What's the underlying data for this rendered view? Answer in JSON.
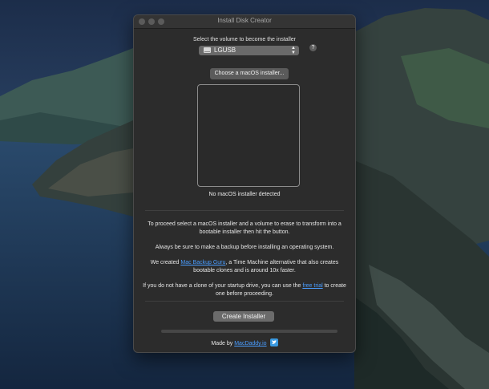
{
  "window": {
    "title": "Install Disk Creator"
  },
  "volume": {
    "label": "Select the volume to become the installer",
    "selected": "LGUSB",
    "help_glyph": "?"
  },
  "installer": {
    "choose_button": "Choose a macOS installer...",
    "status": "No macOS installer detected"
  },
  "info": {
    "p1": "To proceed select a macOS installer and a volume to erase to transform into a bootable installer then hit the button.",
    "p2": "Always be sure to make a backup before installing an operating system.",
    "p3_before": "We created ",
    "p3_link": "Mac Backup Guru",
    "p3_after": ", a Time Machine alternative that also creates bootable clones and is around 10x faster.",
    "p4_before": "If you do not have a clone of your startup drive, you can use the ",
    "p4_link": "free trial",
    "p4_after": " to create one before proceeding."
  },
  "actions": {
    "create_button": "Create Installer",
    "progress": 0
  },
  "footer": {
    "made_by": "Made by ",
    "link": "MacDaddy.io"
  },
  "colors": {
    "link": "#4a9dff",
    "window_bg": "#2c2c2c",
    "twitter": "#3b9ae1"
  },
  "icons": [
    "disk-icon",
    "chevron-updown-icon",
    "help-icon",
    "twitter-icon"
  ]
}
